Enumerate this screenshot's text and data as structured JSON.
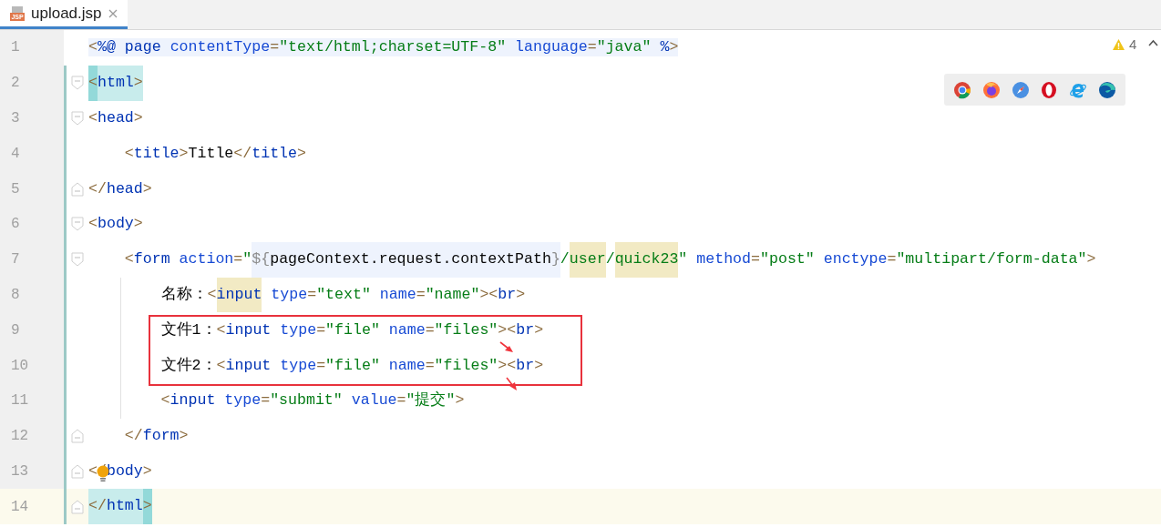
{
  "tab": {
    "icon_label": "JSP",
    "title": "upload.jsp",
    "selected": true
  },
  "inspections": {
    "warnings": "4"
  },
  "lines": [
    {
      "number": "1",
      "kind": "directive",
      "changed": false,
      "current": false,
      "tokens": [
        {
          "kind": "punct",
          "t": "<"
        },
        {
          "kind": "tag",
          "t": "%@"
        },
        {
          "kind": "tag",
          "t": " page"
        },
        {
          "kind": "attr",
          "t": " contentType"
        },
        {
          "kind": "punct",
          "t": "="
        },
        {
          "kind": "string",
          "t": "\"text/html;charset=UTF-8\""
        },
        {
          "kind": "attr",
          "t": " language"
        },
        {
          "kind": "punct",
          "t": "="
        },
        {
          "kind": "string",
          "t": "\"java\""
        },
        {
          "kind": "tag",
          "t": " %"
        },
        {
          "kind": "punct",
          "t": ">"
        }
      ]
    },
    {
      "number": "2",
      "kind": "markup",
      "changed": true,
      "current": false,
      "tokens": [
        {
          "kind": "brace",
          "t": "<"
        },
        {
          "kind": "pairtag",
          "t": "html"
        },
        {
          "kind": "pairpunct",
          "t": ">"
        }
      ],
      "children": [
        {
          "number": "3",
          "kind": "markup",
          "changed": true,
          "current": false,
          "tokens": [
            {
              "kind": "punct",
              "t": "<"
            },
            {
              "kind": "tag",
              "t": "head"
            },
            {
              "kind": "punct",
              "t": ">"
            }
          ],
          "children": [
            {
              "number": "4",
              "kind": "markup",
              "changed": true,
              "current": false,
              "tokens": [
                {
                  "kind": "punct",
                  "t": "<"
                },
                {
                  "kind": "tag",
                  "t": "title"
                },
                {
                  "kind": "punct",
                  "t": ">"
                },
                {
                  "kind": "text",
                  "t": "Title"
                },
                {
                  "kind": "punct",
                  "t": "</"
                },
                {
                  "kind": "tag",
                  "t": "title"
                },
                {
                  "kind": "punct",
                  "t": ">"
                }
              ]
            }
          ],
          "closing": {
            "number": "5",
            "kind": "markup",
            "changed": true,
            "current": false,
            "tokens": [
              {
                "kind": "punct",
                "t": "</"
              },
              {
                "kind": "tag",
                "t": "head"
              },
              {
                "kind": "punct",
                "t": ">"
              }
            ]
          }
        },
        {
          "number": "6",
          "kind": "markup",
          "changed": true,
          "current": false,
          "tokens": [
            {
              "kind": "punct",
              "t": "<"
            },
            {
              "kind": "tag",
              "t": "body"
            },
            {
              "kind": "punct",
              "t": ">"
            }
          ],
          "children": [
            {
              "number": "7",
              "kind": "markup",
              "changed": true,
              "current": false,
              "tokens": [
                {
                  "kind": "punct",
                  "t": "<"
                },
                {
                  "kind": "tag",
                  "t": "form"
                },
                {
                  "kind": "attr",
                  "t": " action"
                },
                {
                  "kind": "punct",
                  "t": "="
                },
                {
                  "kind": "string",
                  "t": "\""
                },
                {
                  "kind": "injectel",
                  "t": "${"
                },
                {
                  "kind": "injecttext",
                  "t": "pageContext.request.contextPath"
                },
                {
                  "kind": "injectel",
                  "t": "}"
                },
                {
                  "kind": "string",
                  "t": "/"
                },
                {
                  "kind": "usagestring",
                  "t": "user"
                },
                {
                  "kind": "string",
                  "t": "/"
                },
                {
                  "kind": "usagestring",
                  "t": "quick23"
                },
                {
                  "kind": "string",
                  "t": "\""
                },
                {
                  "kind": "attr",
                  "t": " method"
                },
                {
                  "kind": "punct",
                  "t": "="
                },
                {
                  "kind": "string",
                  "t": "\"post\""
                },
                {
                  "kind": "attr",
                  "t": " enctype"
                },
                {
                  "kind": "punct",
                  "t": "="
                },
                {
                  "kind": "string",
                  "t": "\"multipart/form-data\""
                },
                {
                  "kind": "punct",
                  "t": ">"
                }
              ],
              "children": [
                {
                  "number": "8",
                  "kind": "markup",
                  "changed": true,
                  "current": false,
                  "tokens": [
                    {
                      "kind": "text",
                      "t": "名称："
                    },
                    {
                      "kind": "punct",
                      "t": "<"
                    },
                    {
                      "kind": "usagetag",
                      "t": "input"
                    },
                    {
                      "kind": "attr",
                      "t": " type"
                    },
                    {
                      "kind": "punct",
                      "t": "="
                    },
                    {
                      "kind": "string",
                      "t": "\"text\""
                    },
                    {
                      "kind": "attr",
                      "t": " name"
                    },
                    {
                      "kind": "punct",
                      "t": "="
                    },
                    {
                      "kind": "string",
                      "t": "\"name\""
                    },
                    {
                      "kind": "punct",
                      "t": "><"
                    },
                    {
                      "kind": "tag",
                      "t": "br"
                    },
                    {
                      "kind": "punct",
                      "t": ">"
                    }
                  ]
                },
                {
                  "number": "9",
                  "kind": "markup",
                  "changed": true,
                  "current": false,
                  "tokens": [
                    {
                      "kind": "text",
                      "t": "文件1："
                    },
                    {
                      "kind": "punct",
                      "t": "<"
                    },
                    {
                      "kind": "tag",
                      "t": "input"
                    },
                    {
                      "kind": "attr",
                      "t": " type"
                    },
                    {
                      "kind": "punct",
                      "t": "="
                    },
                    {
                      "kind": "string",
                      "t": "\"file\""
                    },
                    {
                      "kind": "attr",
                      "t": " name"
                    },
                    {
                      "kind": "punct",
                      "t": "="
                    },
                    {
                      "kind": "string",
                      "t": "\"files\""
                    },
                    {
                      "kind": "punct",
                      "t": "><"
                    },
                    {
                      "kind": "tag",
                      "t": "br"
                    },
                    {
                      "kind": "punct",
                      "t": ">"
                    }
                  ]
                },
                {
                  "number": "10",
                  "kind": "markup",
                  "changed": true,
                  "current": false,
                  "tokens": [
                    {
                      "kind": "text",
                      "t": "文件2："
                    },
                    {
                      "kind": "punct",
                      "t": "<"
                    },
                    {
                      "kind": "tag",
                      "t": "input"
                    },
                    {
                      "kind": "attr",
                      "t": " type"
                    },
                    {
                      "kind": "punct",
                      "t": "="
                    },
                    {
                      "kind": "string",
                      "t": "\"file\""
                    },
                    {
                      "kind": "attr",
                      "t": " name"
                    },
                    {
                      "kind": "punct",
                      "t": "="
                    },
                    {
                      "kind": "string",
                      "t": "\"files\""
                    },
                    {
                      "kind": "punct",
                      "t": "><"
                    },
                    {
                      "kind": "tag",
                      "t": "br"
                    },
                    {
                      "kind": "punct",
                      "t": ">"
                    }
                  ]
                },
                {
                  "number": "11",
                  "kind": "markup",
                  "changed": true,
                  "current": false,
                  "tokens": [
                    {
                      "kind": "punct",
                      "t": "<"
                    },
                    {
                      "kind": "tag",
                      "t": "input"
                    },
                    {
                      "kind": "attr",
                      "t": " type"
                    },
                    {
                      "kind": "punct",
                      "t": "="
                    },
                    {
                      "kind": "string",
                      "t": "\"submit\""
                    },
                    {
                      "kind": "attr",
                      "t": " value"
                    },
                    {
                      "kind": "punct",
                      "t": "="
                    },
                    {
                      "kind": "string",
                      "t": "\"提交\""
                    },
                    {
                      "kind": "punct",
                      "t": ">"
                    }
                  ]
                }
              ],
              "closing": {
                "number": "12",
                "kind": "markup",
                "changed": true,
                "current": false,
                "tokens": [
                  {
                    "kind": "punct",
                    "t": "</"
                  },
                  {
                    "kind": "tag",
                    "t": "form"
                  },
                  {
                    "kind": "punct",
                    "t": ">"
                  }
                ]
              }
            }
          ],
          "closing": {
            "number": "13",
            "kind": "markup",
            "changed": true,
            "current": false,
            "tokens": [
              {
                "kind": "punct",
                "t": "</"
              },
              {
                "kind": "tag",
                "t": "body"
              },
              {
                "kind": "punct",
                "t": ">"
              }
            ]
          }
        }
      ],
      "closing": {
        "number": "14",
        "kind": "markup",
        "changed": true,
        "current": true,
        "tokens": [
          {
            "kind": "pairpunct",
            "t": "</"
          },
          {
            "kind": "pairtag",
            "t": "html"
          },
          {
            "kind": "brace",
            "t": ">"
          }
        ]
      }
    }
  ]
}
